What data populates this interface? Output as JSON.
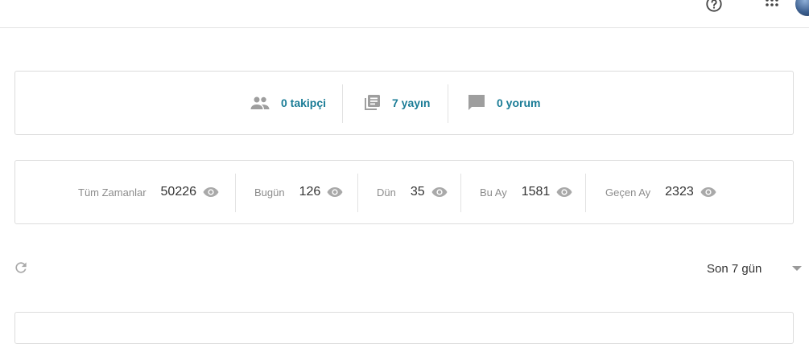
{
  "header": {
    "help_icon": "help-circle-icon",
    "apps_icon": "apps-grid-icon",
    "avatar": "user-avatar"
  },
  "social_stats": [
    {
      "icon": "people-icon",
      "label": "0 takipçi"
    },
    {
      "icon": "library-books-icon",
      "label": "7 yayın"
    },
    {
      "icon": "comment-icon",
      "label": "0 yorum"
    }
  ],
  "view_stats": [
    {
      "label": "Tüm Zamanlar",
      "value": "50226"
    },
    {
      "label": "Bugün",
      "value": "126"
    },
    {
      "label": "Dün",
      "value": "35"
    },
    {
      "label": "Bu Ay",
      "value": "1581"
    },
    {
      "label": "Geçen Ay",
      "value": "2323"
    }
  ],
  "controls": {
    "refresh_icon": "refresh-icon",
    "range_selected": "Son 7 gün"
  },
  "colors": {
    "link": "#1a7c96",
    "icon_gray": "#9e9e9e",
    "border": "#dcdcdc"
  }
}
